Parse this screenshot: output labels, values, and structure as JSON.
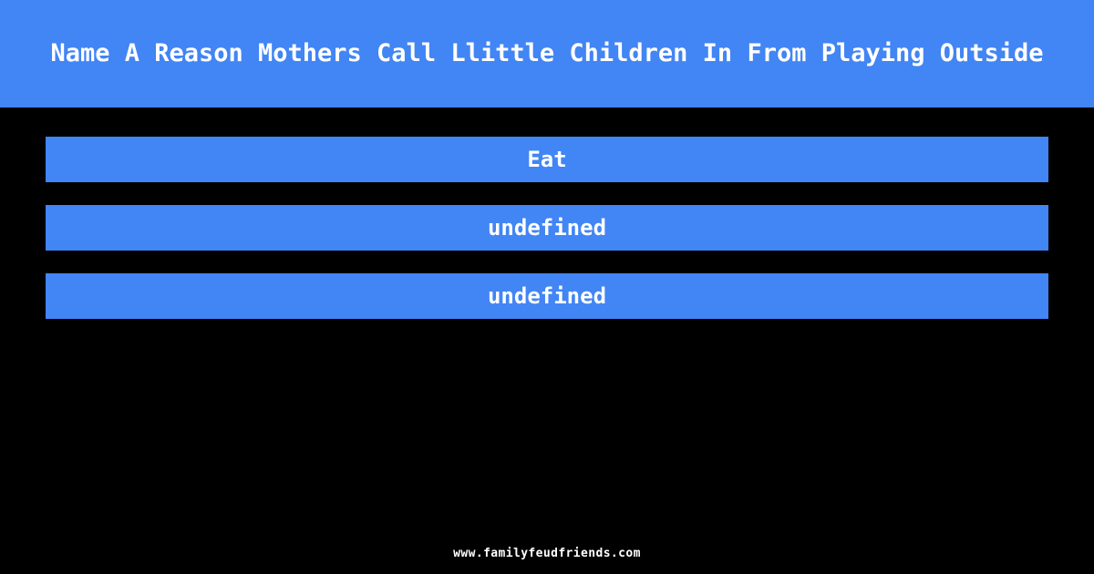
{
  "theme": {
    "background_color": "#000000",
    "accent_color": "#4285f4",
    "text_color": "#ffffff"
  },
  "header": {
    "title": "Name A Reason Mothers Call Llittle Children In From Playing Outside"
  },
  "answers": [
    {
      "text": "Eat"
    },
    {
      "text": "undefined"
    },
    {
      "text": "undefined"
    }
  ],
  "footer": {
    "site_url": "www.familyfeudfriends.com"
  }
}
